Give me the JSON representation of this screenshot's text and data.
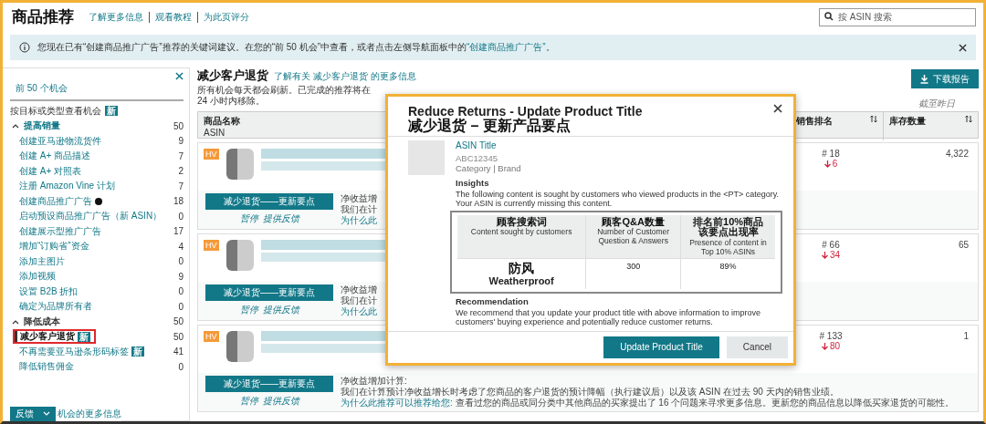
{
  "header": {
    "title": "商品推荐",
    "links": [
      "了解更多信息",
      "观看教程",
      "为此页评分"
    ],
    "search": {
      "placeholder": "按 ASIN 搜索"
    }
  },
  "banner": {
    "text": "您现在已有“创建商品推广广告”推荐的关键词建议。在您的“前 50 机会”中查看，或者点击左侧导航面板中的",
    "link": "“创建商品推广广告”",
    "end": "。"
  },
  "sidebar": {
    "top_link": "前 50 个机会",
    "filter_label": "按目标或类型查看机会",
    "filter_badge": "新",
    "groups": [
      {
        "label": "提高销量",
        "count": "50",
        "expanded": true,
        "items": [
          {
            "label": "创建亚马逊物流货件",
            "count": "9",
            "selected": false,
            "info_icon": false
          },
          {
            "label": "创建 A+ 商品描述",
            "count": "7",
            "selected": false,
            "info_icon": false
          },
          {
            "label": "创建 A+ 对照表",
            "count": "2",
            "selected": false,
            "info_icon": false
          },
          {
            "label": "注册 Amazon Vine 计划",
            "count": "7",
            "selected": false,
            "info_icon": false
          },
          {
            "label": "创建商品推广广告",
            "count": "18",
            "selected": false,
            "info_icon": true
          },
          {
            "label": "启动预设商品推广广告（新 ASIN）",
            "count": "0",
            "selected": false,
            "info_icon": false
          },
          {
            "label": "创建展示型推广广告",
            "count": "17",
            "selected": false,
            "info_icon": false
          },
          {
            "label": "增加“订购省”资金",
            "count": "4",
            "selected": false,
            "info_icon": false
          },
          {
            "label": "添加主图片",
            "count": "0",
            "selected": false,
            "info_icon": false
          },
          {
            "label": "添加视频",
            "count": "9",
            "selected": false,
            "info_icon": false
          },
          {
            "label": "设置 B2B 折扣",
            "count": "0",
            "selected": false,
            "info_icon": false
          },
          {
            "label": "确定为品牌所有者",
            "count": "0",
            "selected": false,
            "info_icon": false
          }
        ]
      },
      {
        "label": "降低成本",
        "count": "50",
        "expanded": true,
        "items": [
          {
            "label": "减少客户退货",
            "badge": "新",
            "count": "50",
            "selected": true,
            "info_icon": false
          },
          {
            "label": "不再需要亚马逊条形码标签",
            "badge": "新",
            "count": "41",
            "selected": false,
            "info_icon": false
          },
          {
            "label": "降低销售佣金",
            "count": "0",
            "selected": false,
            "info_icon": false
          }
        ]
      }
    ],
    "feedback_button": "反馈",
    "more_link": "机会的更多信息"
  },
  "main": {
    "title": "减少客户退货",
    "learn_link": "了解有关 减少客户退货 的更多信息",
    "subtitle": "所有机会每天都会刷新。已完成的推荐将在 24 小时内移除。",
    "download_button": "下载报告",
    "as_of": "截至昨日",
    "columns": [
      {
        "label": "商品名称",
        "sub": "ASIN"
      },
      {
        "label": "销售排名",
        "sortable": true
      },
      {
        "label": "库存数量",
        "sortable": true
      }
    ],
    "rows": [
      {
        "badge": "HV",
        "action": "减少退货——更新要点",
        "links": [
          "暂停",
          "提供反馈"
        ],
        "details": [
          "净收益增",
          "我们在计"
        ],
        "why_link": "为什么此",
        "rank": "# 18",
        "rank_change": "6",
        "inventory": "4,322"
      },
      {
        "badge": "HV",
        "action": "减少退货——更新要点",
        "links": [
          "暂停",
          "提供反馈"
        ],
        "details": [
          "净收益增",
          "我们在计"
        ],
        "why_link": "为什么此",
        "rank": "# 66",
        "rank_change": "34",
        "inventory": "65"
      },
      {
        "badge": "HV",
        "action": "减少退货——更新要点",
        "links": [
          "暂停",
          "提供反馈"
        ],
        "details": [
          "净收益增加计算:",
          "我们在计算预计净收益增长时考虑了您商品的客户退货的预计降幅（执行建议后）以及该 ASIN 在过去 90 天内的销售业绩。"
        ],
        "why_link": "为什么此推荐可以推荐给您:",
        "why_text": "查看过您的商品或同分类中其他商品的买家提出了 16 个问题来寻求更多信息。更新您的商品信息以降低买家退货的可能性。",
        "rank": "# 133",
        "rank_change": "80",
        "inventory": "1"
      }
    ]
  },
  "modal": {
    "title": "Reduce Returns - Update Product Title",
    "title_note": "减少退货 – 更新产品要点",
    "asin_title": "ASIN Title",
    "asin": "ABC12345",
    "meta": "Category | Brand",
    "insights_heading": "Insights",
    "insights_text": "The following content is sought by customers who viewed products in the <PT> category. Your ASIN is currently missing this content.",
    "column_notes": [
      [
        "顾客搜索词"
      ],
      [
        "顾客Q&A数量"
      ],
      [
        "排名前10%商品",
        "该要点出现率"
      ]
    ],
    "columns": [
      "Content sought by customers",
      "Number of Customer Question & Answers",
      "Presence of content in Top 10% ASINs"
    ],
    "rows": [
      {
        "note": "防风",
        "cells": [
          "Weatherproof",
          "300",
          "89%"
        ]
      }
    ],
    "recommendation_heading": "Recommendation",
    "recommendation_text": "We recommend that you update your product title with above information to improve customers' buying experience and potentially reduce customer returns.",
    "buttons": [
      {
        "label": "Update Product Title",
        "kind": "primary"
      },
      {
        "label": "Cancel",
        "kind": "secondary"
      }
    ]
  }
}
